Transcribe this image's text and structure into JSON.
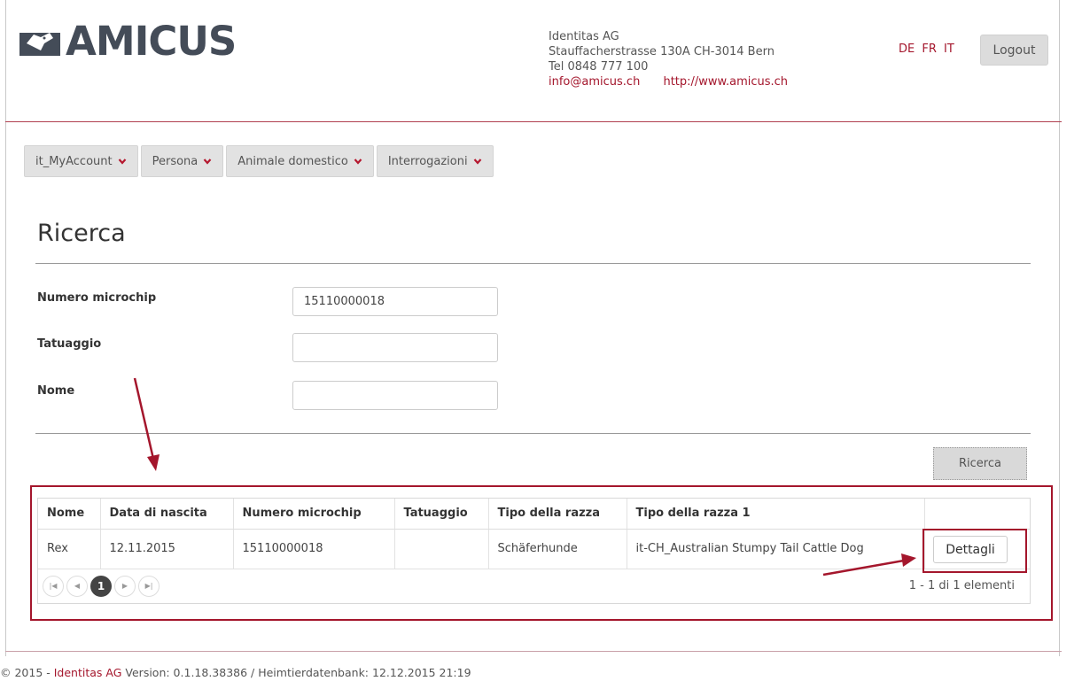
{
  "brand": {
    "logo_text": "AMICUS"
  },
  "company": {
    "name": "Identitas AG",
    "address": "Stauffacherstrasse 130A CH-3014 Bern",
    "phone": "Tel 0848 777 100",
    "email": "info@amicus.ch",
    "website": "http://www.amicus.ch"
  },
  "languages": [
    "DE",
    "FR",
    "IT"
  ],
  "logout_label": "Logout",
  "nav": [
    "it_MyAccount",
    "Persona",
    "Animale domestico",
    "Interrogazioni"
  ],
  "page_title": "Ricerca",
  "form": {
    "microchip_label": "Numero microchip",
    "microchip_value": "15110000018",
    "tattoo_label": "Tatuaggio",
    "tattoo_value": "",
    "name_label": "Nome",
    "name_value": ""
  },
  "search_button": "Ricerca",
  "results": {
    "columns": [
      "Nome",
      "Data di nascita",
      "Numero microchip",
      "Tatuaggio",
      "Tipo della razza",
      "Tipo della razza 1",
      ""
    ],
    "rows": [
      [
        "Rex",
        "12.11.2015",
        "15110000018",
        "",
        "Schäferhunde",
        "it-CH_Australian Stumpy Tail Cattle Dog"
      ]
    ],
    "details_button": "Dettagli",
    "current_page": "1",
    "pager_info": "1 - 1 di 1 elementi"
  },
  "footer": {
    "prefix": "© 2015 - ",
    "company_link": "Identitas AG",
    "text": " Version: 0.1.18.38386 / Heimtierdatenbank: 12.12.2015 21:19"
  },
  "colors": {
    "accent": "#a4162c",
    "logo": "#444c58",
    "nav_bg": "#e2e2e2"
  }
}
